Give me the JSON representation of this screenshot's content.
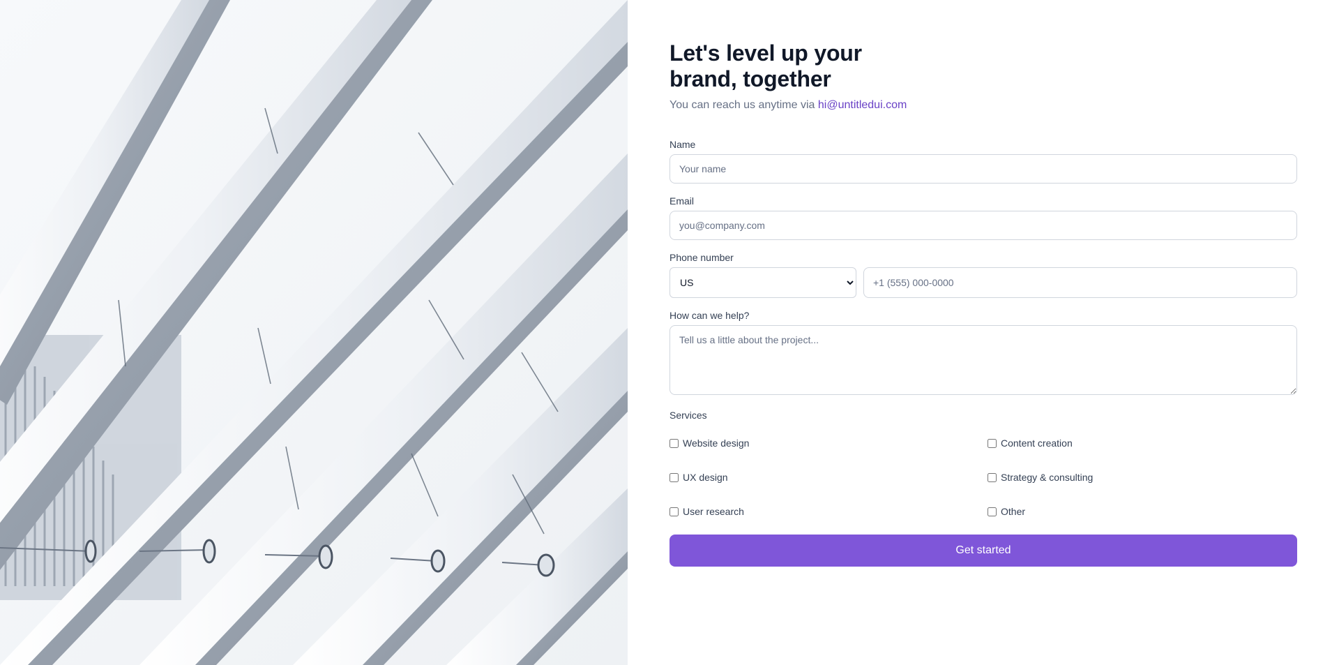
{
  "hero": {
    "image_name": "architecture-photo",
    "background": "#eef1f5"
  },
  "header": {
    "title": "Let's level up your brand, together",
    "subtitle_prefix": "You can reach us anytime via ",
    "email": "hi@untitledui.com"
  },
  "form": {
    "name": {
      "label": "Name",
      "placeholder": "Your name"
    },
    "email": {
      "label": "Email",
      "placeholder": "you@company.com"
    },
    "phone": {
      "label": "Phone number",
      "country": "US",
      "placeholder": "+1 (555) 000-0000"
    },
    "help": {
      "label": "How can we help?",
      "placeholder": "Tell us a little about the project..."
    },
    "services": {
      "label": "Services",
      "items": [
        {
          "label": "Website design"
        },
        {
          "label": "Content creation"
        },
        {
          "label": "UX design"
        },
        {
          "label": "Strategy & consulting"
        },
        {
          "label": "User research"
        },
        {
          "label": "Other"
        }
      ]
    },
    "submit_label": "Get started"
  },
  "colors": {
    "accent": "#7f56d9",
    "link": "#6941c6",
    "heading": "#101828",
    "muted": "#667085",
    "border": "#d0d5dd"
  }
}
